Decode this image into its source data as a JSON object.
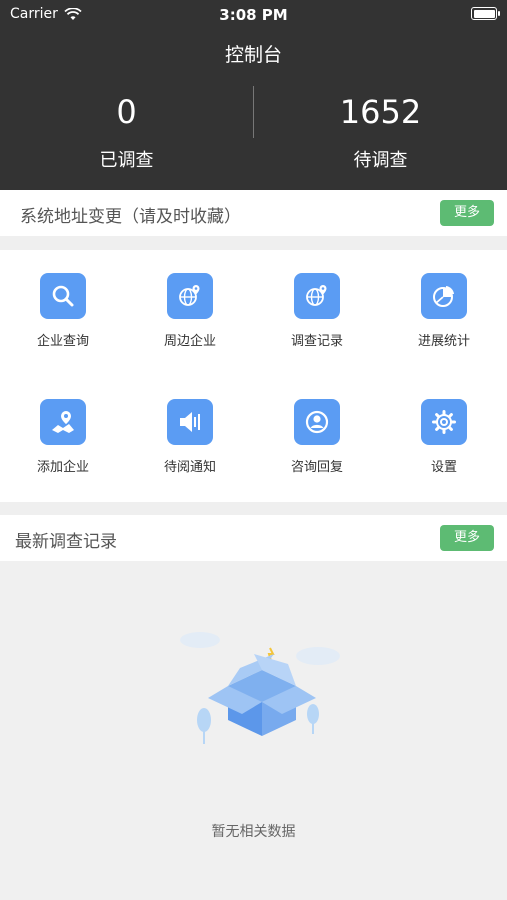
{
  "status_bar": {
    "carrier": "Carrier",
    "time": "3:08 PM"
  },
  "header": {
    "title": "控制台",
    "stats": [
      {
        "value": "0",
        "label": "已调查"
      },
      {
        "value": "1652",
        "label": "待调查"
      }
    ]
  },
  "notice": {
    "text": "系统地址变更（请及时收藏）",
    "more_label": "更多"
  },
  "grid": {
    "items": [
      {
        "label": "企业查询",
        "icon": "search-icon"
      },
      {
        "label": "周边企业",
        "icon": "globe-pin-icon"
      },
      {
        "label": "调查记录",
        "icon": "globe-pin-icon"
      },
      {
        "label": "进展统计",
        "icon": "pie-chart-icon"
      },
      {
        "label": "添加企业",
        "icon": "map-pin-icon"
      },
      {
        "label": "待阅通知",
        "icon": "speaker-icon"
      },
      {
        "label": "咨询回复",
        "icon": "user-circle-icon"
      },
      {
        "label": "设置",
        "icon": "gear-icon"
      }
    ]
  },
  "records": {
    "title": "最新调查记录",
    "more_label": "更多",
    "empty_text": "暂无相关数据"
  },
  "colors": {
    "header_bg": "#333333",
    "accent_blue": "#5b9cf3",
    "more_green": "#5dbb73"
  }
}
